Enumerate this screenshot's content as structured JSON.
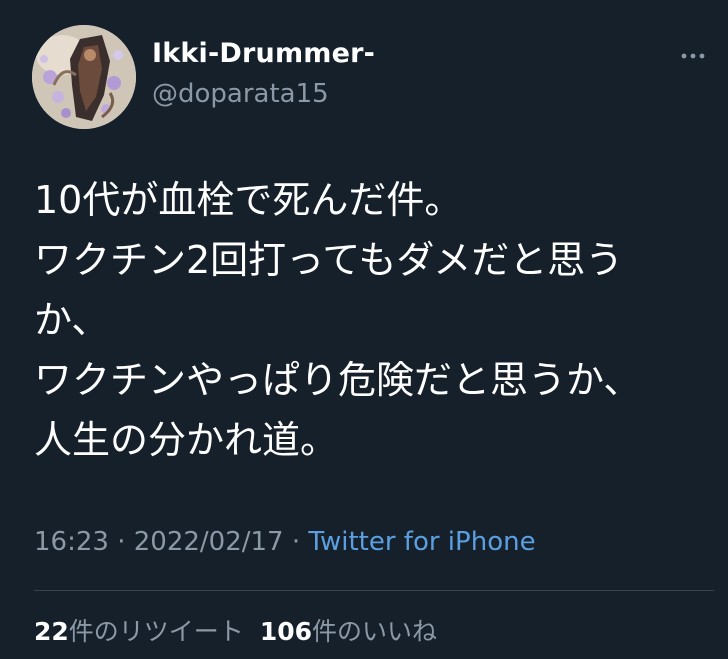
{
  "user": {
    "display_name": "Ikki-Drummer-",
    "handle": "@doparata15"
  },
  "tweet": {
    "lines": [
      "10代が血栓で死んだ件。",
      "ワクチン2回打ってもダメだと思う",
      "か、",
      "ワクチンやっぱり危険だと思うか、",
      "人生の分かれ道。"
    ]
  },
  "meta": {
    "time": "16:23",
    "separator": " · ",
    "date": "2022/02/17",
    "source": "Twitter for iPhone"
  },
  "stats": {
    "retweets_count": "22",
    "retweets_label": "件のリツイート",
    "likes_count": "106",
    "likes_label": "件のいいね"
  },
  "icons": {
    "more": "more-horizontal-icon"
  },
  "colors": {
    "background": "#15202b",
    "primary_text": "#ffffff",
    "secondary_text": "#8b98a5",
    "link": "#5c9fe0",
    "divider": "#38444d"
  }
}
